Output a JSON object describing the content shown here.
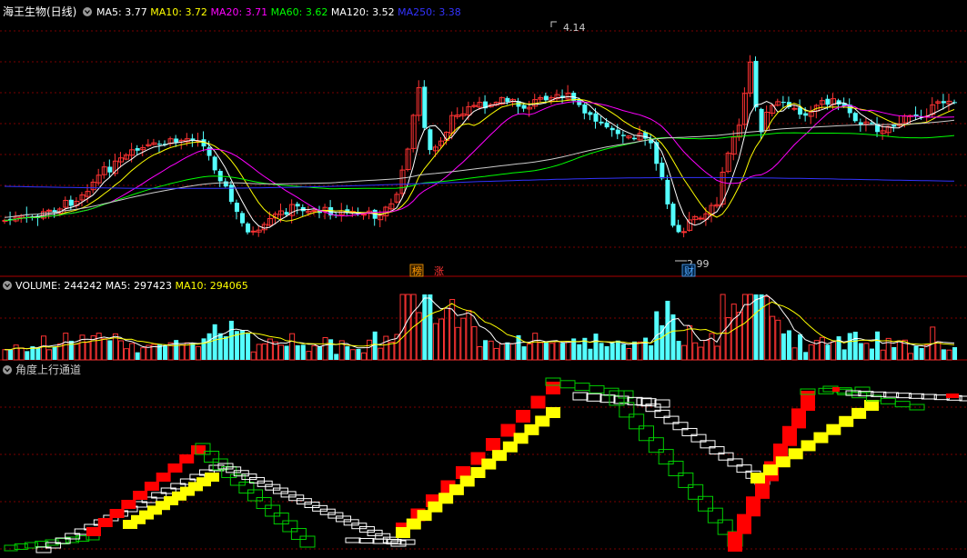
{
  "main_panel": {
    "title": "海王生物(日线)",
    "indicators": [
      {
        "label": "MA5:",
        "value": "3.77",
        "color": "#ffffff"
      },
      {
        "label": "MA10:",
        "value": "3.72",
        "color": "#ffff00"
      },
      {
        "label": "MA20:",
        "value": "3.71",
        "color": "#ff00ff"
      },
      {
        "label": "MA60:",
        "value": "3.62",
        "color": "#00ff00"
      },
      {
        "label": "MA120:",
        "value": "3.52",
        "color": "#ffffff"
      },
      {
        "label": "MA250:",
        "value": "3.38",
        "color": "#3333ff"
      }
    ],
    "high_label": "4.14",
    "low_label": "2.99",
    "markers": [
      {
        "text": "榜",
        "color": "#ff9900"
      },
      {
        "text": "涨",
        "color": "#ff3333"
      },
      {
        "text": "财",
        "color": "#55aaff"
      }
    ]
  },
  "volume_panel": {
    "title": "VOLUME:",
    "value": "244242",
    "indicators": [
      {
        "label": "MA5:",
        "value": "297423",
        "color": "#ffffff"
      },
      {
        "label": "MA10:",
        "value": "294065",
        "color": "#ffff00"
      }
    ]
  },
  "indicator_panel": {
    "title": "角度上行通道"
  },
  "colors": {
    "up": "#ff3333",
    "down": "#54ffff",
    "grid": "#8b0000",
    "border": "#aa0000",
    "step_red": "#ff0000",
    "step_yellow": "#ffff00",
    "step_green": "#00cc00",
    "step_white": "#ffffff"
  }
}
